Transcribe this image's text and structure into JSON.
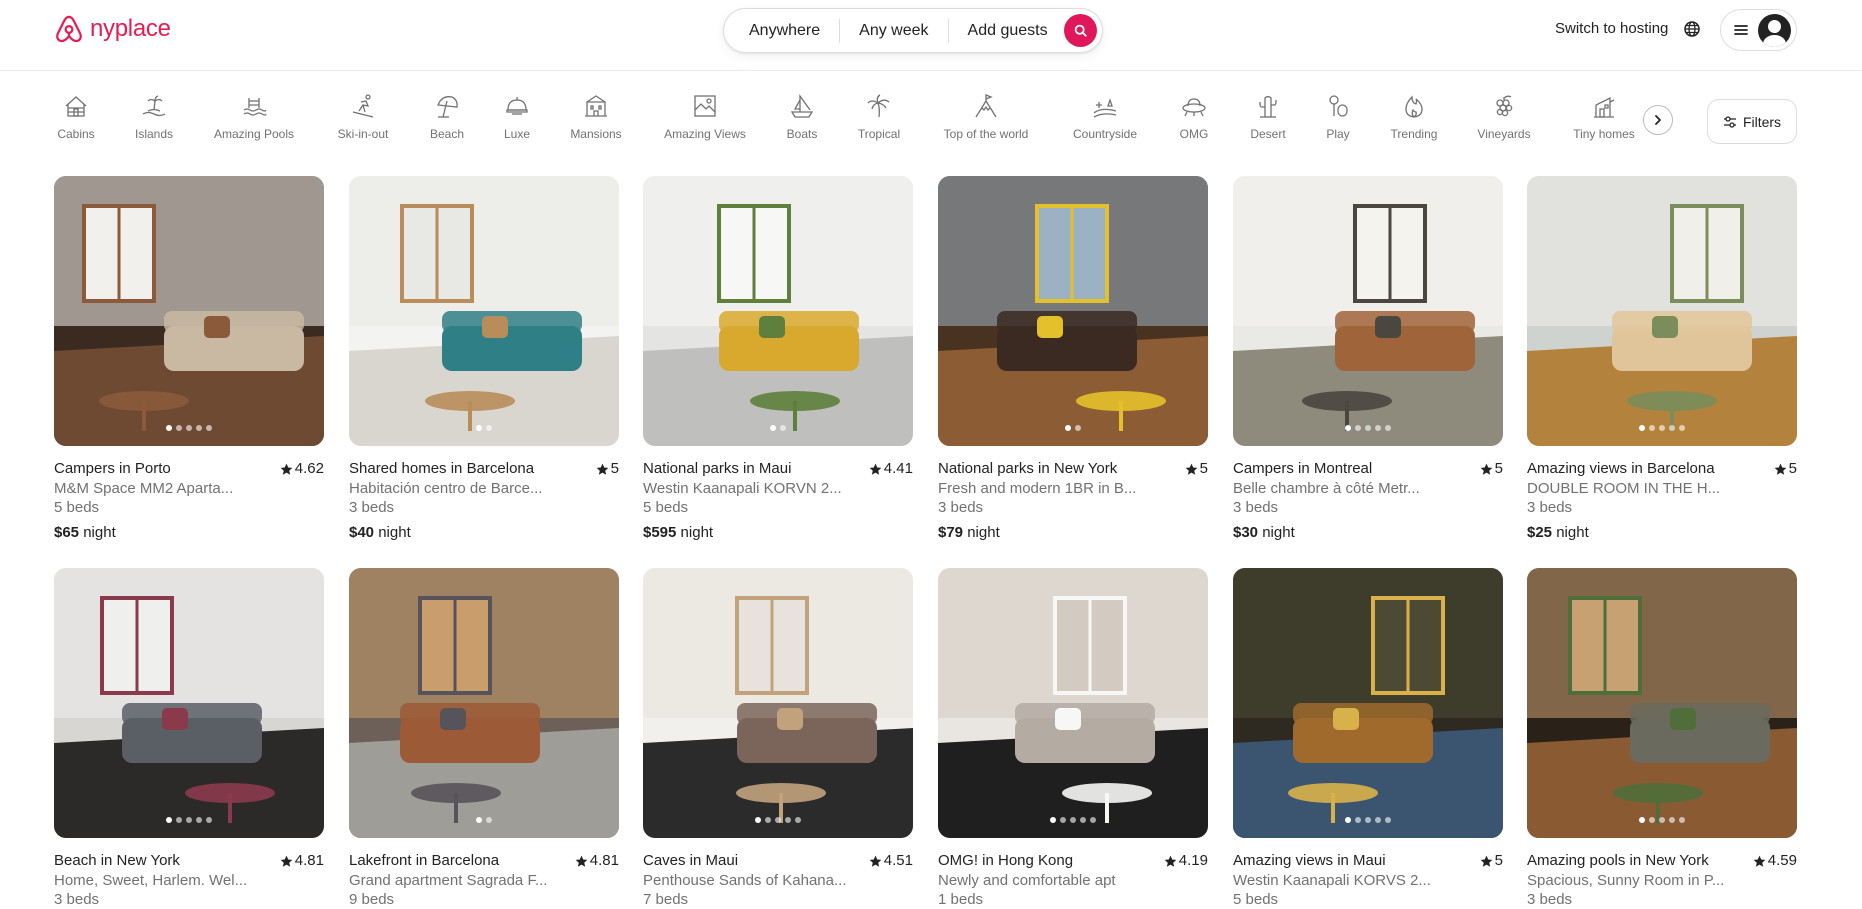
{
  "brand": {
    "name": "nyplace",
    "color": "#e51d53"
  },
  "search": {
    "where": "Anywhere",
    "when": "Any week",
    "who": "Add guests"
  },
  "header": {
    "host_label": "Switch to hosting"
  },
  "categories": [
    {
      "label": "Cabins",
      "icon": "cabin-icon"
    },
    {
      "label": "Islands",
      "icon": "island-icon"
    },
    {
      "label": "Amazing Pools",
      "icon": "pool-icon"
    },
    {
      "label": "Ski-in-out",
      "icon": "ski-icon"
    },
    {
      "label": "Beach",
      "icon": "umbrella-icon"
    },
    {
      "label": "Luxe",
      "icon": "luxe-icon"
    },
    {
      "label": "Mansions",
      "icon": "mansion-icon"
    },
    {
      "label": "Amazing Views",
      "icon": "views-icon"
    },
    {
      "label": "Boats",
      "icon": "boat-icon"
    },
    {
      "label": "Tropical",
      "icon": "palm-icon"
    },
    {
      "label": "Top of the world",
      "icon": "summit-icon"
    },
    {
      "label": "Countryside",
      "icon": "countryside-icon"
    },
    {
      "label": "OMG",
      "icon": "ufo-icon"
    },
    {
      "label": "Desert",
      "icon": "cactus-icon"
    },
    {
      "label": "Play",
      "icon": "play-icon"
    },
    {
      "label": "Trending",
      "icon": "fire-icon"
    },
    {
      "label": "Vineyards",
      "icon": "grapes-icon"
    },
    {
      "label": "Tiny homes",
      "icon": "tiny-home-icon"
    }
  ],
  "filters_label": "Filters",
  "listings": [
    {
      "title": "Campers in Porto",
      "rating": "4.62",
      "subtitle": "M&M Space MM2 Aparta...",
      "beds": "5 beds",
      "price": "$65",
      "unit": "night"
    },
    {
      "title": "Shared homes in Barcelona",
      "rating": "5",
      "subtitle": "Habitación centro de Barce...",
      "beds": "3 beds",
      "price": "$40",
      "unit": "night"
    },
    {
      "title": "National parks in Maui",
      "rating": "4.41",
      "subtitle": "Westin Kaanapali KORVN 2...",
      "beds": "5 beds",
      "price": "$595",
      "unit": "night"
    },
    {
      "title": "National parks in New York",
      "rating": "5",
      "subtitle": "Fresh and modern 1BR in B...",
      "beds": "3 beds",
      "price": "$79",
      "unit": "night"
    },
    {
      "title": "Campers in Montreal",
      "rating": "5",
      "subtitle": "Belle chambre à côté Metr...",
      "beds": "3 beds",
      "price": "$30",
      "unit": "night"
    },
    {
      "title": "Amazing views in Barcelona",
      "rating": "5",
      "subtitle": "DOUBLE ROOM IN THE H...",
      "beds": "3 beds",
      "price": "$25",
      "unit": "night"
    },
    {
      "title": "Beach in New York",
      "rating": "4.81",
      "subtitle": "Home, Sweet, Harlem. Wel...",
      "beds": "3 beds",
      "price": "",
      "unit": ""
    },
    {
      "title": "Lakefront in Barcelona",
      "rating": "4.81",
      "subtitle": "Grand apartment Sagrada F...",
      "beds": "9 beds",
      "price": "",
      "unit": ""
    },
    {
      "title": "Caves in Maui",
      "rating": "4.51",
      "subtitle": "Penthouse Sands of Kahana...",
      "beds": "7 beds",
      "price": "",
      "unit": ""
    },
    {
      "title": "OMG! in Hong Kong",
      "rating": "4.19",
      "subtitle": "Newly and comfortable apt",
      "beds": "1 beds",
      "price": "",
      "unit": ""
    },
    {
      "title": "Amazing views in Maui",
      "rating": "5",
      "subtitle": "Westin Kaanapali KORVS 2...",
      "beds": "5 beds",
      "price": "",
      "unit": ""
    },
    {
      "title": "Amazing pools in New York",
      "rating": "4.59",
      "subtitle": "Spacious, Sunny Room in P...",
      "beds": "3 beds",
      "price": "",
      "unit": ""
    }
  ]
}
